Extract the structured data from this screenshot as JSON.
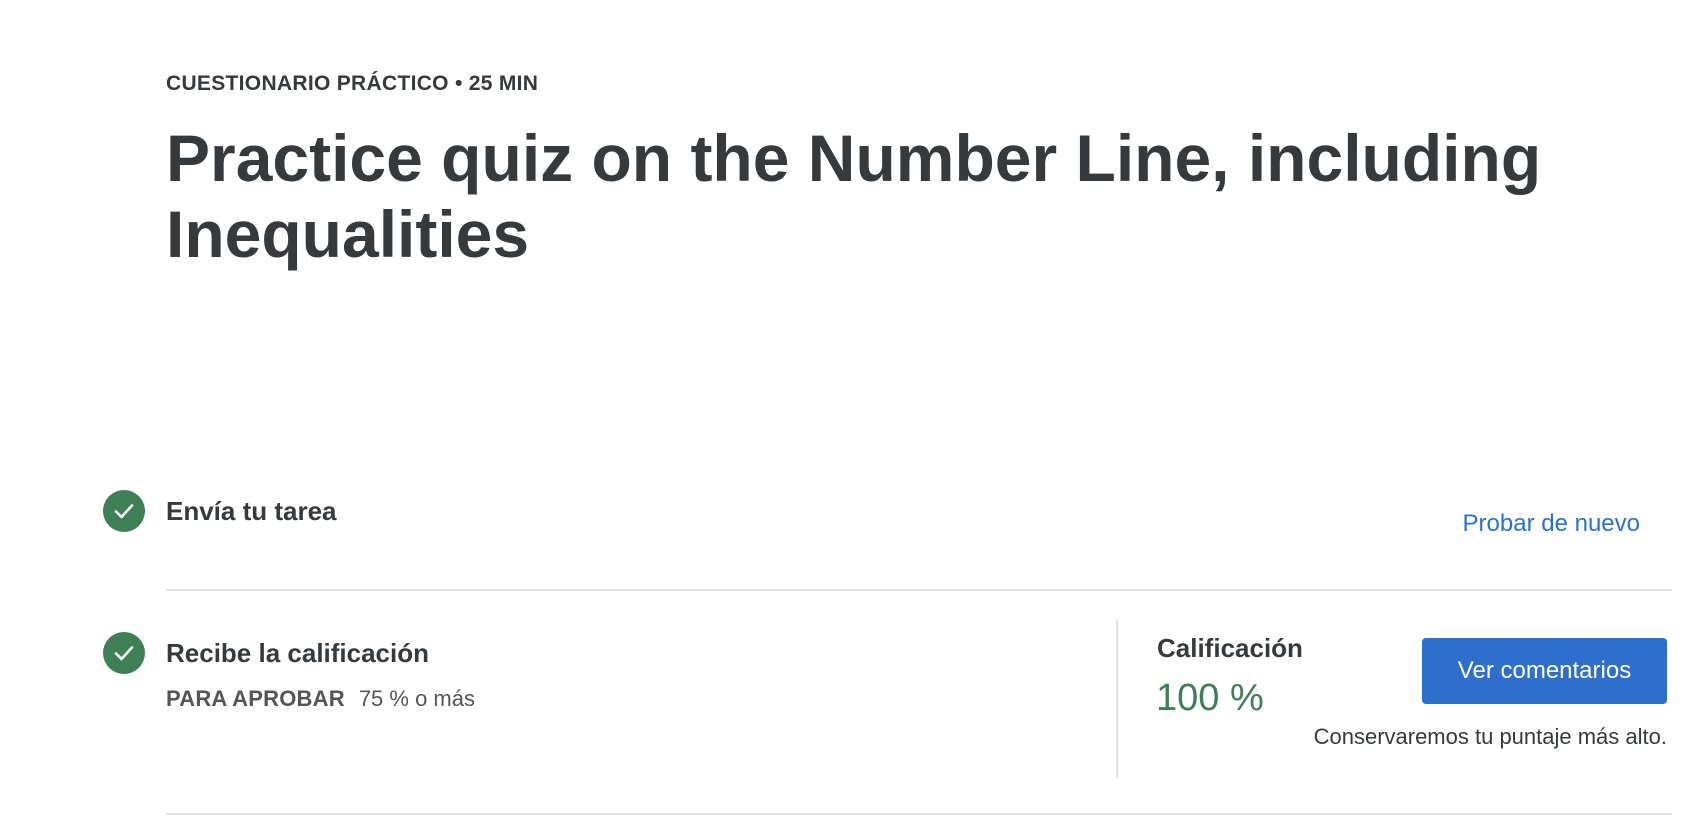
{
  "header": {
    "eyebrow": "CUESTIONARIO PRÁCTICO • 25 MIN",
    "title": "Practice quiz on the Number Line, including Inequalities"
  },
  "steps": [
    {
      "status_icon": "check-circle-icon",
      "title": "Envía tu tarea",
      "action_label": "Probar de nuevo"
    },
    {
      "status_icon": "check-circle-icon",
      "title": "Recibe la calificación",
      "pass_label": "PARA APROBAR",
      "pass_value": "75 % o más"
    }
  ],
  "grade": {
    "label": "Calificación",
    "value": "100 %",
    "button_label": "Ver comentarios",
    "note": "Conservaremos tu puntaje más alto."
  },
  "colors": {
    "success": "#3e7f56",
    "link": "#2a73cc",
    "primary_button": "#2f6fcc",
    "text": "#373a3c",
    "divider": "#e1e1e1"
  }
}
